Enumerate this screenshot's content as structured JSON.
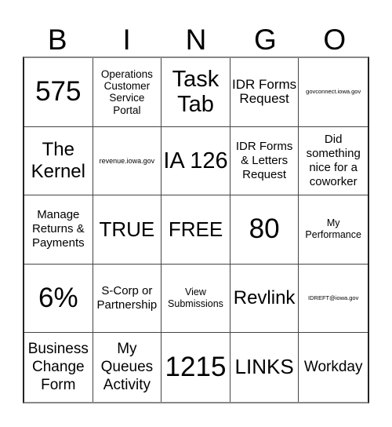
{
  "header": {
    "letters": [
      "B",
      "I",
      "N",
      "G",
      "O"
    ]
  },
  "board": {
    "cells": [
      "575",
      "Operations Customer Service Portal",
      "Task Tab",
      "IDR Forms Request",
      "govconnect.iowa.gov",
      "The Kernel",
      "revenue.iowa.gov",
      "IA 126",
      "IDR Forms & Letters Request",
      "Did something nice for a coworker",
      "Manage Returns & Payments",
      "TRUE",
      "FREE",
      "80",
      "My Performance",
      "6%",
      "S-Corp or Partnership",
      "View Submissions",
      "Revlink",
      "IDREFT@iowa.gov",
      "Business Change Form",
      "My Queues Activity",
      "1215",
      "LINKS",
      "Workday"
    ],
    "free_space_index": 12
  }
}
